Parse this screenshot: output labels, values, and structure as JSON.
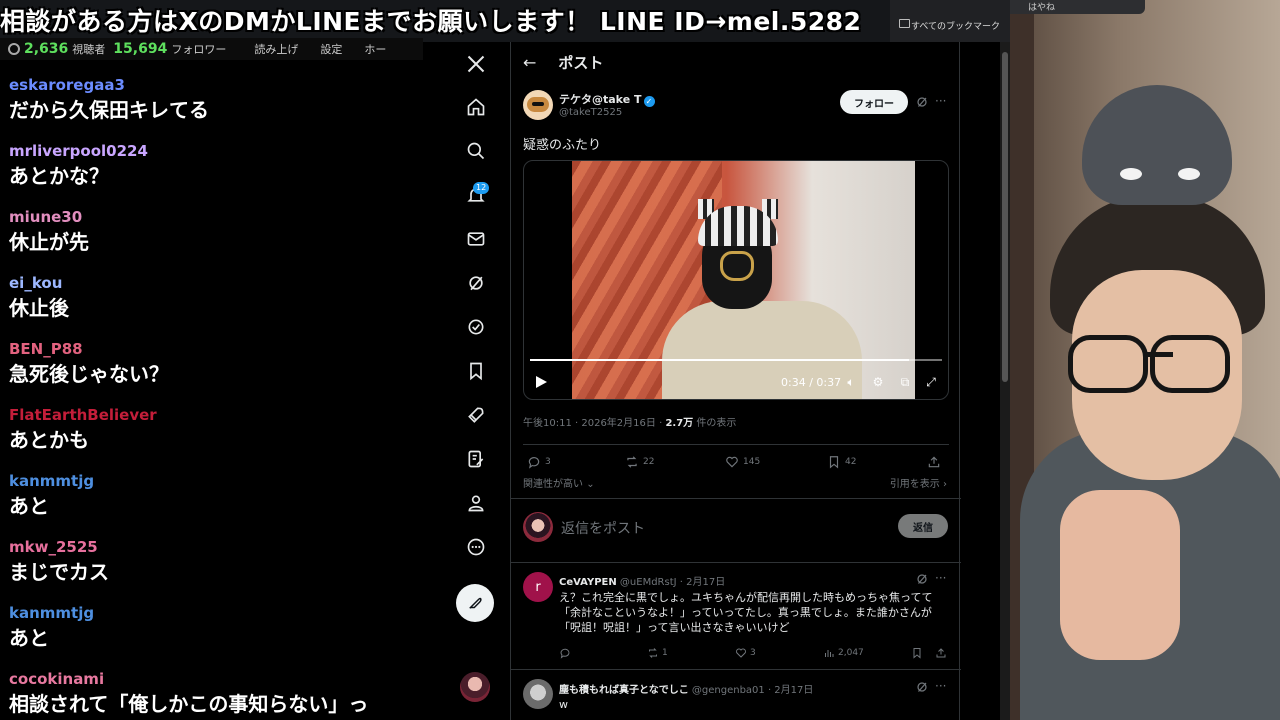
{
  "banner": {
    "text": "相談がある方はXのDMかLINEまでお願いします！ LINE ID→mel.5282",
    "bookmarks_label": "すべてのブックマーク"
  },
  "stats": {
    "viewers": "2,636",
    "viewers_label": "視聴者",
    "followers": "15,694",
    "followers_label": "フォロワー",
    "menu": [
      "読み上げ",
      "設定",
      "ホー"
    ]
  },
  "chat": [
    {
      "user": "eskaroregaa3",
      "text": "だから久保田キレてる",
      "color": "#6b8cff"
    },
    {
      "user": "mrliverpool0224",
      "text": "あとかな？",
      "color": "#c9a6ff"
    },
    {
      "user": "miune30",
      "text": "休止が先",
      "color": "#e28fbf"
    },
    {
      "user": "ei_kou",
      "text": "休止後",
      "color": "#9db8ff"
    },
    {
      "user": "BEN_P88",
      "text": "急死後じゃない？",
      "color": "#e2627f"
    },
    {
      "user": "FlatEarthBeliever",
      "text": "あとかも",
      "color": "#c41e3a"
    },
    {
      "user": "kanmmtjg",
      "text": "あと",
      "color": "#4e8fe0"
    },
    {
      "user": "mkw_2525",
      "text": "まじでカス",
      "color": "#e7709d"
    },
    {
      "user": "kanmmtjg",
      "text": "あと",
      "color": "#4e8fe0"
    },
    {
      "user": "cocokinami",
      "text": "相談されて「俺しかこの事知らない」っ",
      "color": "#e879a0"
    }
  ],
  "x": {
    "nav_badge": "12",
    "header_title": "ポスト",
    "post": {
      "author_name": "テケタ@take T",
      "author_handle": "@takeT2525",
      "follow_label": "フォロー",
      "text": "疑惑のふたり",
      "video_time": "0:34 / 0:37",
      "video_progress": 0.92,
      "timestamp": "午後10:11 · 2026年2月16日 · ",
      "views": "2.7万",
      "views_label": " 件の表示",
      "replies": "3",
      "reposts": "22",
      "likes": "145",
      "bookmarks": "42",
      "relevance_label": "関連性が高い",
      "quotes_label": "引用を表示"
    },
    "reply_box": {
      "placeholder": "返信をポスト",
      "button": "返信"
    },
    "comments": [
      {
        "name": "CeVAYPEN",
        "handle": "@uEMdRstJ · 2月17日",
        "avatar_letter": "r",
        "lines": [
          "え？これ完全に黒でしょ。ユキちゃんが配信再開した時もめっちゃ焦ってて",
          "「余計なこというなよ！」っていってたし。真っ黒でしょ。また誰かさんが",
          "「呪詛！呪詛！」って言い出さなきゃいいけど"
        ],
        "replies": "",
        "reposts": "1",
        "likes": "3",
        "views": "2,047"
      },
      {
        "name": "塵も積もれば真子となでしこ",
        "handle": "@gengenba01 · 2月17日",
        "lines": [
          "w"
        ]
      }
    ]
  },
  "webcam": {
    "tab_text": "はやね"
  }
}
